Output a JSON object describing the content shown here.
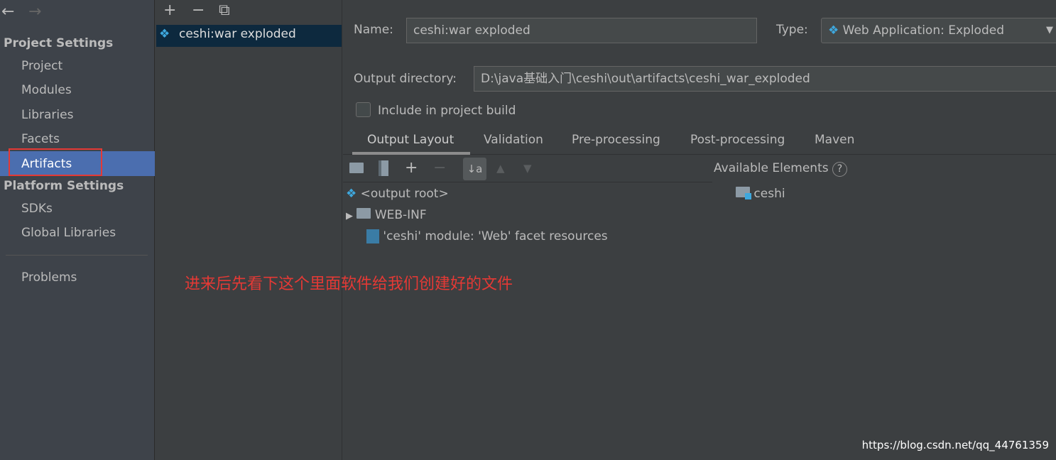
{
  "nav": {
    "back": "←",
    "forward": "→"
  },
  "sidebar": {
    "project_settings": "Project Settings",
    "items": [
      "Project",
      "Modules",
      "Libraries",
      "Facets",
      "Artifacts"
    ],
    "platform_settings": "Platform Settings",
    "platform_items": [
      "SDKs",
      "Global Libraries"
    ],
    "problems": "Problems"
  },
  "artifacts": {
    "toolbar": {
      "add": "+",
      "remove": "−",
      "copy": "⧉"
    },
    "list": [
      "ceshi:war exploded"
    ]
  },
  "form": {
    "name_label": "Name:",
    "name_value": "ceshi:war exploded",
    "type_label": "Type:",
    "type_value": "Web Application: Exploded",
    "output_label": "Output directory:",
    "output_value": "D:\\java基础入门\\ceshi\\out\\artifacts\\ceshi_war_exploded",
    "include_label": "Include in project build",
    "include_checked": false
  },
  "tabs": [
    "Output Layout",
    "Validation",
    "Pre-processing",
    "Post-processing",
    "Maven"
  ],
  "active_tab": "Output Layout",
  "tree": [
    "<output root>",
    "WEB-INF",
    "'ceshi' module: 'Web' facet resources"
  ],
  "available": {
    "title": "Available Elements",
    "help": "?",
    "items": [
      "ceshi"
    ]
  },
  "annotation": "进来后先看下这个里面软件给我们创建好的文件",
  "watermark": "https://blog.csdn.net/qq_44761359",
  "colors": {
    "selected": "#4b6eaf",
    "highlight": "#e53935",
    "list_selected": "#0d293e"
  }
}
